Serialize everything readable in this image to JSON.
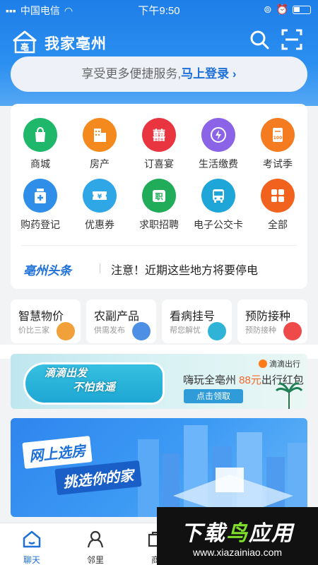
{
  "status_bar": {
    "carrier": "中国电信",
    "time": "下午9:50"
  },
  "header": {
    "app_title": "我家亳州"
  },
  "login_banner": {
    "prompt": "享受更多便捷服务,",
    "link": "马上登录"
  },
  "services": [
    {
      "label": "商城",
      "icon": "shopping-bag-icon",
      "color": "#1fb86a"
    },
    {
      "label": "房产",
      "icon": "building-icon",
      "color": "#f48a1e"
    },
    {
      "label": "订喜宴",
      "icon": "double-happiness-icon",
      "color": "#e8353f"
    },
    {
      "label": "生活缴费",
      "icon": "lightning-icon",
      "color": "#8b63e6"
    },
    {
      "label": "考试季",
      "icon": "exam-paper-icon",
      "color": "#f47b20"
    },
    {
      "label": "购药登记",
      "icon": "medicine-bottle-icon",
      "color": "#2f8fe8"
    },
    {
      "label": "优惠券",
      "icon": "coupon-icon",
      "color": "#2fa6e6"
    },
    {
      "label": "求职招聘",
      "icon": "job-icon",
      "color": "#20ac58"
    },
    {
      "label": "电子公交卡",
      "icon": "bus-icon",
      "color": "#1ea6d8"
    },
    {
      "label": "全部",
      "icon": "grid-icon",
      "color": "#f2621f"
    }
  ],
  "news": {
    "tag": "亳州头条",
    "headline": "注意！近期这些地方将要停电"
  },
  "quick_cards": [
    {
      "title": "智慧物价",
      "subtitle": "价比三家",
      "icon_color": "#f1a03a"
    },
    {
      "title": "农副产品",
      "subtitle": "供需发布",
      "icon_color": "#4e8fe6"
    },
    {
      "title": "看病挂号",
      "subtitle": "帮您解忧",
      "icon_color": "#2fb4d8"
    },
    {
      "title": "预防接种",
      "subtitle": "预防接种",
      "icon_color": "#ef4a4a"
    }
  ],
  "promo": {
    "slogan_1": "滴滴出发",
    "slogan_2": "不怕贫遥",
    "brand": "滴滴出行",
    "offer_prefix": "嗨玩全亳州 ",
    "offer_amount": "88元",
    "offer_suffix": "出行红包",
    "cta": "点击领取"
  },
  "house_banner": {
    "line_1": "网上选房",
    "line_2": "挑选你的家"
  },
  "tabbar": [
    {
      "label": "聊天",
      "icon": "home-icon"
    },
    {
      "label": "邻里",
      "icon": "neighbors-icon"
    },
    {
      "label": "商",
      "icon": "shop-icon"
    }
  ],
  "watermark": {
    "logo_a": "下载",
    "logo_b": "鸟",
    "logo_c": "应用",
    "url": "www.xiazainiao.com"
  }
}
